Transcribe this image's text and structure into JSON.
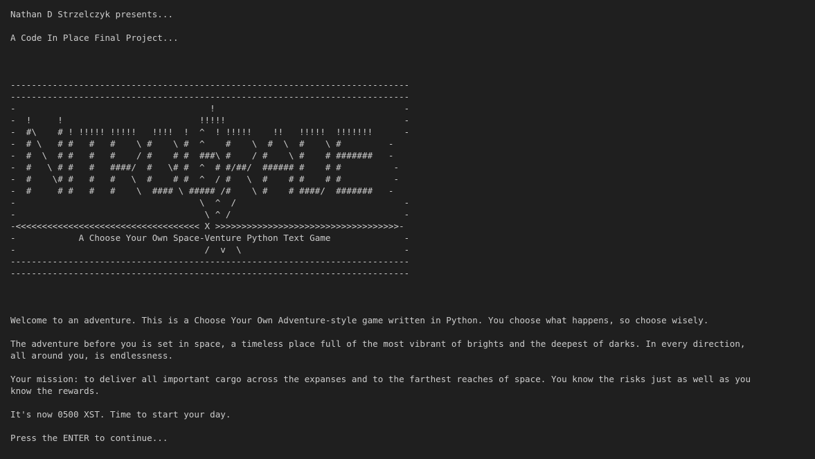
{
  "intro": {
    "presents": "Nathan D Strzelczyk presents...",
    "project": "A Code In Place Final Project..."
  },
  "banner": [
    "----------------------------------------------------------------------------",
    "----------------------------------------------------------------------------",
    "-                                     !                                    -",
    "-  !     !                          !!!!!                                  -",
    "-  #\\    # ! !!!!! !!!!!   !!!!  !  ^  ! !!!!!    !!   !!!!!  !!!!!!!      -",
    "-  # \\   # #   #   #    \\ #    \\ #  ^    #    \\  #  \\  #    \\ #         -",
    "-  #  \\  # #   #   #    / #    # #  ###\\ #    / #    \\ #    # #######   -",
    "-  #   \\ # #   #   ####/  #   \\# #  ^  # #/##/  ###### #    # #          -",
    "-  #    \\# #   #   #   \\  #    # #  ^  / #   \\  #    # #    # #          -",
    "-  #     # #   #   #    \\  #### \\ ##### /#    \\ #    # ####/  #######   -",
    "-                                   \\  ^  /                                -",
    "-                                    \\ ^ /                                 -",
    "-<<<<<<<<<<<<<<<<<<<<<<<<<<<<<<<<<<< X >>>>>>>>>>>>>>>>>>>>>>>>>>>>>>>>>>>-",
    "-            A Choose Your Own Space-Venture Python Text Game              -",
    "-                                    /  v  \\                               -",
    "----------------------------------------------------------------------------",
    "----------------------------------------------------------------------------"
  ],
  "story": {
    "welcome": "Welcome to an adventure. This is a Choose Your Own Adventure-style game written in Python. You choose what happens, so choose wisely.",
    "setting": "The adventure before you is set in space, a timeless place full of the most vibrant of brights and the deepest of darks. In every direction, all around you, is endlessness.",
    "mission": "Your mission: to deliver all important cargo across the expanses and to the farthest reaches of space. You know the risks just as well as you know the rewards.",
    "time": "It's now 0500 XST. Time to start your day.",
    "prompt": "Press the ENTER to continue..."
  }
}
